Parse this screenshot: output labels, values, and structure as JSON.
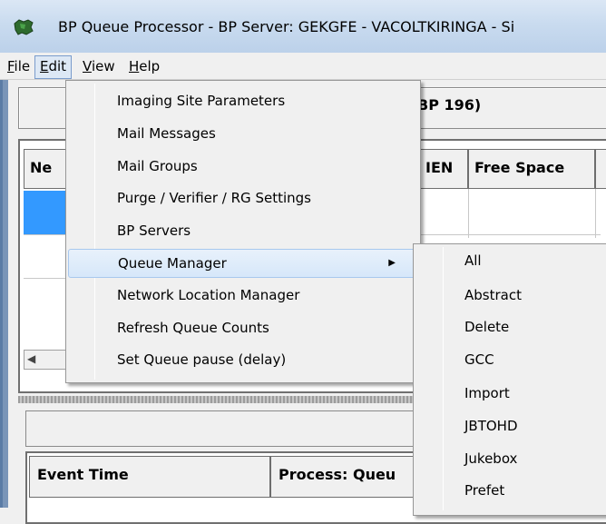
{
  "window": {
    "title": "BP Queue Processor   -   BP Server: GEKGFE - VACOLTKIRINGA   -   Si"
  },
  "menubar": {
    "items": [
      {
        "accel": "F",
        "rest": "ile"
      },
      {
        "accel": "E",
        "rest": "dit"
      },
      {
        "accel": "V",
        "rest": "iew"
      },
      {
        "accel": "H",
        "rest": "elp"
      }
    ]
  },
  "header_button": {
    "text": "BP 196)"
  },
  "grid": {
    "columns": [
      "Ne",
      "IEN",
      "Free Space",
      ""
    ]
  },
  "events": {
    "columns": [
      "Event Time",
      "Process: Queu"
    ]
  },
  "edit_menu": {
    "items": [
      {
        "label": "Imaging Site Parameters"
      },
      {
        "label": "Mail Messages"
      },
      {
        "label": "Mail Groups"
      },
      {
        "label": "Purge / Verifier / RG Settings"
      },
      {
        "label": "BP Servers"
      },
      {
        "label": "Queue Manager",
        "submenu": true,
        "highlighted": true
      },
      {
        "label": "Network Location Manager"
      },
      {
        "label": "Refresh Queue Counts"
      },
      {
        "label": "Set Queue pause (delay)"
      }
    ],
    "submenu_arrow": "▶"
  },
  "queue_submenu": {
    "items": [
      "All",
      "Abstract",
      "Delete",
      "GCC",
      "Import",
      "JBTOHD",
      "Jukebox",
      "Prefet"
    ]
  },
  "icons": {
    "app": "app-map-icon",
    "scroll_left": "◀"
  },
  "colors": {
    "selection": "#3399ff",
    "menu_highlight": "#d6e7fa"
  }
}
